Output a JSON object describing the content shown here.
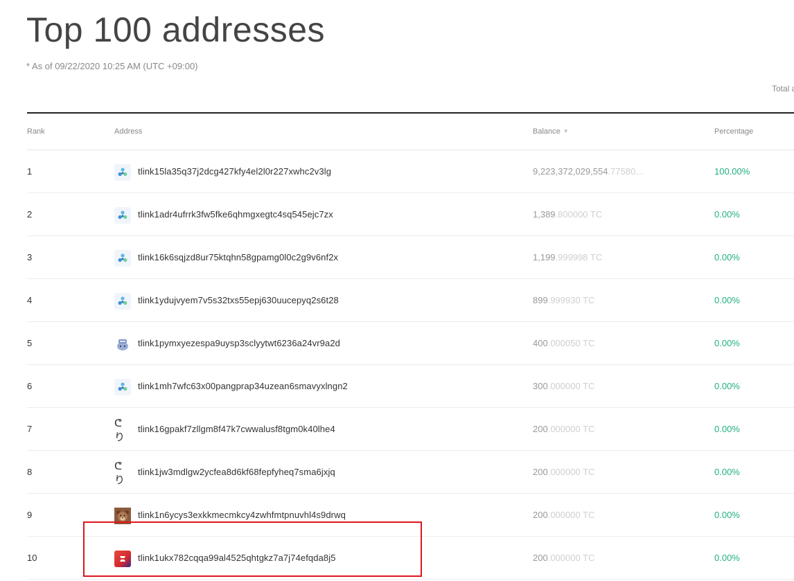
{
  "page": {
    "title": "Top 100 addresses",
    "as_of": "* As of 09/22/2020 10:25 AM (UTC +09:00)",
    "total_label": "Total a"
  },
  "table": {
    "headers": {
      "rank": "Rank",
      "address": "Address",
      "balance": "Balance",
      "percentage": "Percentage"
    },
    "rows": [
      {
        "rank": "1",
        "icon": "molecule-icon",
        "address": "tlink15la35q37j2dcg427kfy4el2l0r227xwhc2v3lg",
        "balance_int": "9,223,372,029,554",
        "balance_frac": ".77580…",
        "percentage": "100.00%"
      },
      {
        "rank": "2",
        "icon": "molecule-icon",
        "address": "tlink1adr4ufrrk3fw5fke6qhmgxegtc4sq545ejc7zx",
        "balance_int": "1,389",
        "balance_frac": ".800000 TC",
        "percentage": "0.00%"
      },
      {
        "rank": "3",
        "icon": "molecule-icon",
        "address": "tlink16k6sqjzd8ur75ktqhn58gpamg0l0c2g9v6nf2x",
        "balance_int": "1,199",
        "balance_frac": ".999998 TC",
        "percentage": "0.00%"
      },
      {
        "rank": "4",
        "icon": "molecule-icon",
        "address": "tlink1ydujvyem7v5s32txs55epj630uucepyq2s6t28",
        "balance_int": "899",
        "balance_frac": ".999930 TC",
        "percentage": "0.00%"
      },
      {
        "rank": "5",
        "icon": "mascot-icon",
        "address": "tlink1pymxyezespa9uysp3sclyytwt6236a24vr9a2d",
        "balance_int": "400",
        "balance_frac": ".000050 TC",
        "percentage": "0.00%"
      },
      {
        "rank": "6",
        "icon": "molecule-icon",
        "address": "tlink1mh7wfc63x00pangprap34uzean6smavyxlngn2",
        "balance_int": "300",
        "balance_frac": ".000000 TC",
        "percentage": "0.00%"
      },
      {
        "rank": "7",
        "icon": "script-logo-icon",
        "address": "tlink16gpakf7zllgm8f47k7cwwalusf8tgm0k40lhe4",
        "balance_int": "200",
        "balance_frac": ".000000 TC",
        "percentage": "0.00%"
      },
      {
        "rank": "8",
        "icon": "script-logo-icon",
        "address": "tlink1jw3mdlgw2ycfea8d6kf68fepfyheq7sma6jxjq",
        "balance_int": "200",
        "balance_frac": ".000000 TC",
        "percentage": "0.00%"
      },
      {
        "rank": "9",
        "icon": "bear-icon",
        "address": "tlink1n6ycys3exkkmecmkcy4zwhfmtpnuvhl4s9drwq",
        "balance_int": "200",
        "balance_frac": ".000000 TC",
        "percentage": "0.00%"
      },
      {
        "rank": "10",
        "icon": "red-app-icon",
        "address": "tlink1ukx782cqqa99al4525qhtgkz7a7j74efqda8j5",
        "balance_int": "200",
        "balance_frac": ".000000 TC",
        "percentage": "0.00%"
      }
    ]
  },
  "colors": {
    "percentage_green": "#22b07d",
    "highlight_red": "#e0141c",
    "header_rule": "#222222"
  }
}
